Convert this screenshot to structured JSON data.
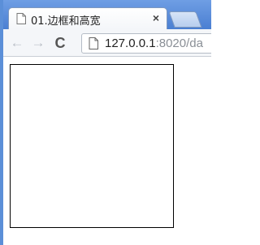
{
  "browser": {
    "tab": {
      "title": "01.边框和高宽",
      "close_glyph": "×",
      "icon": "page-icon"
    },
    "new_tab_icon": "new-tab-icon",
    "toolbar": {
      "back_glyph": "←",
      "forward_glyph": "→",
      "reload_glyph": "C",
      "url_host": "127.0.0.1",
      "url_rest": ":8020/da"
    }
  },
  "colors": {
    "frame_blue": "#5b8fd8",
    "box_border": "#000000"
  }
}
